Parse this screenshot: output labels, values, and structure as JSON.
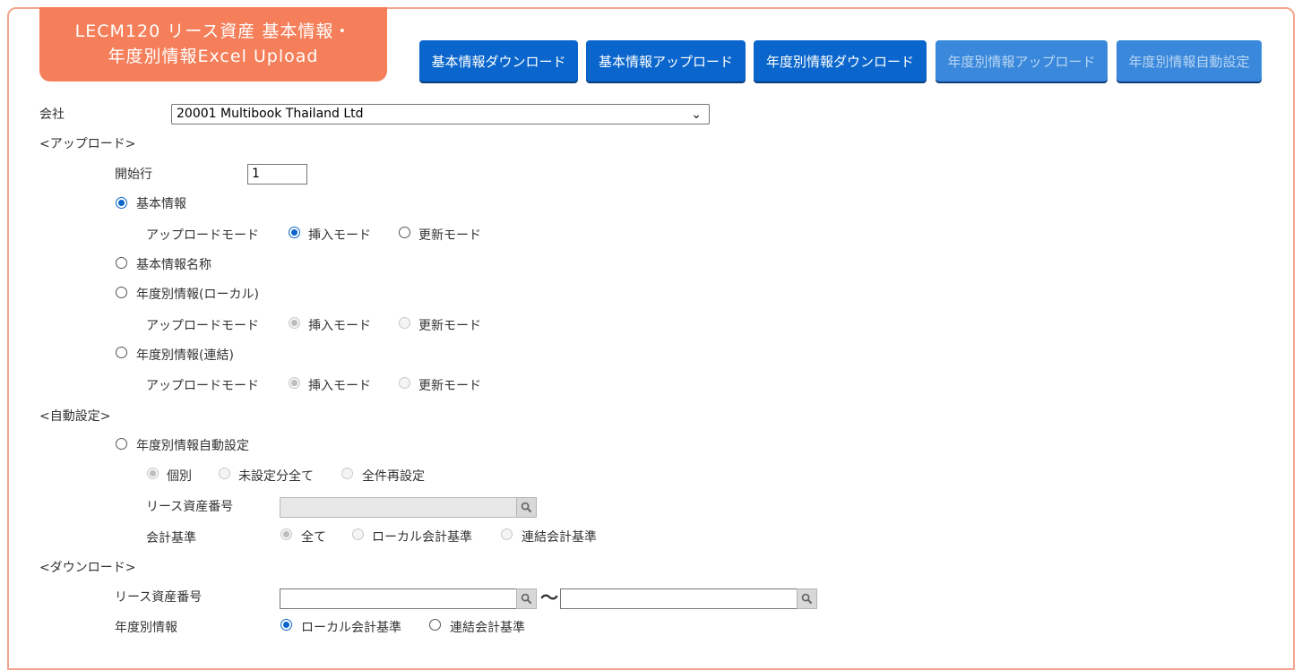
{
  "title": {
    "line1": "LECM120 リース資産 基本情報・",
    "line2": "年度別情報Excel Upload"
  },
  "toolbar": {
    "basic_download": "基本情報ダウンロード",
    "basic_upload": "基本情報アップロード",
    "yearly_download": "年度別情報ダウンロード",
    "yearly_upload": "年度別情報アップロード",
    "yearly_auto": "年度別情報自動設定"
  },
  "company": {
    "label": "会社",
    "value": "20001 Multibook Thailand Ltd"
  },
  "upload": {
    "section": "<アップロード>",
    "start_row_label": "開始行",
    "start_row_value": "1",
    "basic_info": "基本情報",
    "mode_label": "アップロードモード",
    "insert_mode": "挿入モード",
    "update_mode": "更新モード",
    "basic_name": "基本情報名称",
    "yearly_local": "年度別情報(ローカル)",
    "yearly_consolidated": "年度別情報(連結)"
  },
  "auto": {
    "section": "<自動設定>",
    "yearly_auto": "年度別情報自動設定",
    "individual": "個別",
    "unset_all": "未設定分全て",
    "reset_all": "全件再設定",
    "asset_no_label": "リース資産番号",
    "accounting_label": "会計基準",
    "all": "全て",
    "local_std": "ローカル会計基準",
    "consolidated_std": "連結会計基準"
  },
  "download": {
    "section": "<ダウンロード>",
    "asset_no_label": "リース資産番号",
    "tilde": "〜",
    "yearly_label": "年度別情報",
    "local_std": "ローカル会計基準",
    "consolidated_std": "連結会計基準"
  },
  "colors": {
    "title_bg": "#f47f5a",
    "button": "#0a66cc",
    "border": "#f4a591"
  }
}
